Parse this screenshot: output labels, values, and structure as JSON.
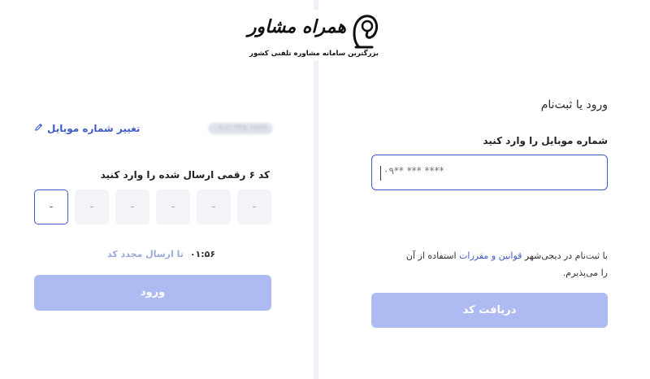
{
  "logo": {
    "title": "همراه مشاور",
    "subtitle": "بزرگترین سامانه مشاوره تلفنی کشور"
  },
  "otp_panel": {
    "masked_phone": "۰۹۱۲ ۳۴۵ ۶۷۸۹",
    "change_number_label": "تغییر شماره موبایل",
    "code_label": "کد ۶ رقمی ارسال شده را وارد کنید",
    "digits": [
      "-",
      "-",
      "-",
      "-",
      "-",
      "-"
    ],
    "timer": "۰۱:۵۶",
    "resend_label": "تا ارسال مجدد کد",
    "login_button": "ورود"
  },
  "login_panel": {
    "title": "ورود یا ثبت‌نام",
    "phone_label": "شماره موبایل را وارد کنید",
    "phone_placeholder": "۰۹** *** ****",
    "terms_prefix": "با ثبت‌نام در دیجی‌شهر ",
    "terms_link": "قوانین و مقررات",
    "terms_suffix": " استفاده از آن را می‌پذیرم.",
    "get_code_button": "دریافت کد"
  },
  "colors": {
    "accent": "#3e5bc8",
    "button_disabled": "#aebbf2",
    "otp_box_bg": "#f2f4f7",
    "divider": "#eef1f5"
  }
}
